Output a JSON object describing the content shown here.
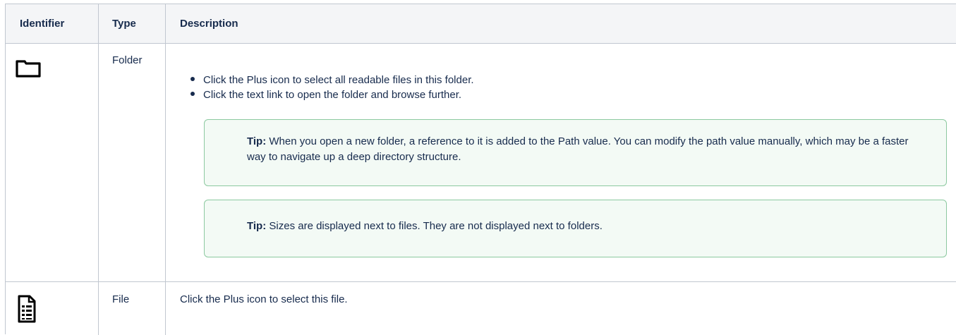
{
  "table": {
    "headers": {
      "identifier": "Identifier",
      "type": "Type",
      "description": "Description"
    },
    "rows": [
      {
        "icon": "folder-icon",
        "type": "Folder",
        "bullets": [
          "Click the Plus icon to select all readable files in this folder.",
          "Click the text link to open the folder and browse further."
        ],
        "tips": [
          {
            "label": "Tip:",
            "text": "When you open a new folder, a reference to it is added to the Path value. You can modify the path value manually, which may be a faster way to navigate up a deep directory structure."
          },
          {
            "label": "Tip:",
            "text": "Sizes are displayed next to files. They are not displayed next to folders."
          }
        ]
      },
      {
        "icon": "file-icon",
        "type": "File",
        "description": "Click the Plus icon to select this file."
      }
    ]
  },
  "colors": {
    "header_bg": "#f4f5f7",
    "border": "#c1c7d0",
    "tip_border": "#8cc9a0",
    "tip_bg": "#f3faf5",
    "text": "#172b4d"
  }
}
